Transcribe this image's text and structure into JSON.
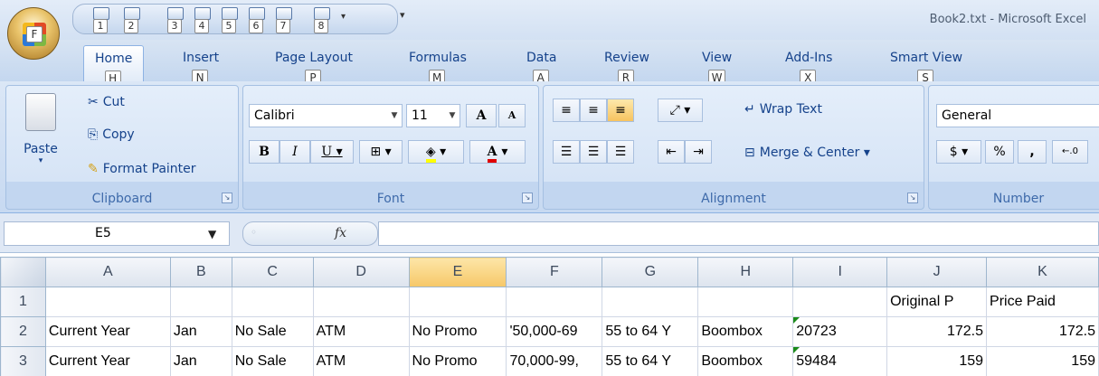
{
  "window": {
    "title": "Book2.txt - Microsoft Excel"
  },
  "office_button": {
    "keytip": "F"
  },
  "quick_access": {
    "items": [
      {
        "icon": "save-icon",
        "keytip": "1"
      },
      {
        "icon": "undo-icon",
        "keytip": "2"
      },
      {
        "icon": "print-preview-icon",
        "keytip": "3"
      },
      {
        "icon": "spelling-icon",
        "keytip": "4"
      },
      {
        "icon": "copy-sheet-icon",
        "keytip": "5"
      },
      {
        "icon": "open-icon",
        "keytip": "6"
      },
      {
        "icon": "print-icon",
        "keytip": "7"
      },
      {
        "icon": "redo-icon",
        "keytip": "8"
      }
    ]
  },
  "tabs": [
    {
      "label": "Home",
      "keytip": "H",
      "active": true
    },
    {
      "label": "Insert",
      "keytip": "N"
    },
    {
      "label": "Page Layout",
      "keytip": "P"
    },
    {
      "label": "Formulas",
      "keytip": "M"
    },
    {
      "label": "Data",
      "keytip": "A"
    },
    {
      "label": "Review",
      "keytip": "R"
    },
    {
      "label": "View",
      "keytip": "W"
    },
    {
      "label": "Add-Ins",
      "keytip": "X"
    },
    {
      "label": "Smart View",
      "keytip": "S"
    }
  ],
  "ribbon": {
    "clipboard": {
      "label": "Clipboard",
      "paste": "Paste",
      "cut": "Cut",
      "copy": "Copy",
      "format_painter": "Format Painter"
    },
    "font": {
      "label": "Font",
      "font_name": "Calibri",
      "font_size": "11",
      "bold": "B",
      "italic": "I",
      "underline": "U",
      "grow": "A",
      "shrink": "A",
      "font_color_glyph": "A"
    },
    "alignment": {
      "label": "Alignment",
      "wrap_text": "Wrap Text",
      "merge_center": "Merge & Center"
    },
    "number": {
      "label": "Number",
      "format": "General",
      "percent": "%",
      "comma": ","
    }
  },
  "formula_bar": {
    "name_box": "E5",
    "fx": "fx",
    "formula": ""
  },
  "sheet": {
    "columns": [
      "A",
      "B",
      "C",
      "D",
      "E",
      "F",
      "G",
      "H",
      "I",
      "J",
      "K"
    ],
    "selected_column": "E",
    "rows": [
      {
        "num": "1",
        "cells": [
          "",
          "",
          "",
          "",
          "",
          "",
          "",
          "",
          "",
          "Original P",
          "Price Paid"
        ]
      },
      {
        "num": "2",
        "cells": [
          "Current Year",
          "Jan",
          "No Sale",
          "ATM",
          "No Promo",
          "'50,000-69",
          "55 to 64 Y",
          "Boombox",
          "20723",
          "172.5",
          "172.5"
        ]
      },
      {
        "num": "3",
        "cells": [
          "Current Year",
          "Jan",
          "No Sale",
          "ATM",
          "No Promo",
          "70,000-99,",
          "55 to 64 Y",
          "Boombox",
          "59484",
          "159",
          "159"
        ]
      }
    ]
  }
}
